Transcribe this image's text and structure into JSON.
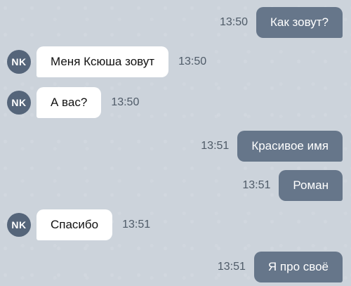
{
  "contact": {
    "initials": "NK"
  },
  "messages": [
    {
      "text": "Как зовут?",
      "time": "13:50"
    },
    {
      "text": "Меня Ксюша зовут",
      "time": "13:50"
    },
    {
      "text": "А вас?",
      "time": "13:50"
    },
    {
      "text": "Красивое имя",
      "time": "13:51"
    },
    {
      "text": "Роман",
      "time": "13:51"
    },
    {
      "text": "Спасибо",
      "time": "13:51"
    },
    {
      "text": "Я про своё",
      "time": "13:51"
    }
  ]
}
